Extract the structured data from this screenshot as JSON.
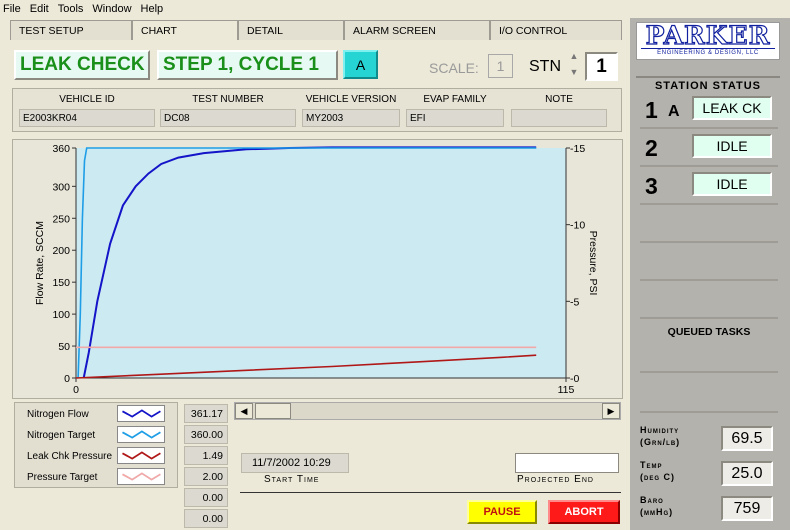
{
  "menu": [
    "File",
    "Edit",
    "Tools",
    "Window",
    "Help"
  ],
  "tabs": [
    "TEST SETUP",
    "CHART",
    "DETAIL",
    "ALARM SCREEN",
    "I/O CONTROL"
  ],
  "header": {
    "mode": "LEAK CHECK",
    "step": "STEP 1, CYCLE  1",
    "station_letter": "A",
    "scale_label": "SCALE:",
    "scale_value": "1",
    "stn_label": "STN",
    "stn_value": "1"
  },
  "info": [
    {
      "header": "VEHICLE ID",
      "value": "E2003KR04"
    },
    {
      "header": "TEST NUMBER",
      "value": "DC08"
    },
    {
      "header": "VEHICLE VERSION",
      "value": "MY2003"
    },
    {
      "header": "EVAP FAMILY",
      "value": "EFI"
    },
    {
      "header": "NOTE",
      "value": ""
    }
  ],
  "chart_data": {
    "type": "line",
    "ylabel": "Flow Rate, SCCM",
    "y2label": "Pressure, PSI",
    "xlim": [
      0,
      115
    ],
    "ylim": [
      0,
      360
    ],
    "y2lim": [
      0,
      15
    ],
    "x_ticks": [
      "0",
      "115"
    ],
    "y_ticks": [
      "0",
      "50",
      "100",
      "150",
      "200",
      "250",
      "300",
      "360"
    ],
    "y2_ticks": [
      "-0",
      "-5",
      "-10",
      "-15"
    ],
    "grid": false,
    "series": [
      {
        "name": "Nitrogen Flow",
        "axis": "left",
        "color": "#1414c8",
        "x": [
          1.8,
          3,
          5,
          8,
          11,
          14,
          17,
          20,
          24,
          30,
          40,
          50,
          60,
          80,
          100,
          108
        ],
        "y": [
          0,
          40,
          120,
          210,
          270,
          300,
          320,
          335,
          345,
          352,
          358,
          360,
          361,
          361,
          361,
          361
        ]
      },
      {
        "name": "Nitrogen Target",
        "axis": "left",
        "color": "#1e9ee6",
        "x": [
          0.5,
          1,
          1.5,
          2,
          2.5,
          108
        ],
        "y": [
          0,
          100,
          250,
          340,
          360,
          360
        ]
      },
      {
        "name": "Leak Chk Pressure",
        "axis": "right",
        "color": "#b01818",
        "x": [
          0,
          20,
          40,
          60,
          80,
          100,
          108
        ],
        "y": [
          0.0,
          0.25,
          0.5,
          0.75,
          1.05,
          1.35,
          1.49
        ]
      },
      {
        "name": "Pressure Target",
        "axis": "right",
        "color": "#f0a8a8",
        "x": [
          0,
          108
        ],
        "y": [
          2.0,
          2.0
        ]
      }
    ]
  },
  "legend": [
    "Nitrogen Flow",
    "Nitrogen Target",
    "Leak Chk Pressure",
    "Pressure Target"
  ],
  "values": [
    "361.17",
    "360.00",
    "1.49",
    "2.00",
    "0.00",
    "0.00"
  ],
  "start_time": {
    "value": "11/7/2002  10:29",
    "label": "Start Time"
  },
  "projected_end": {
    "value": "",
    "label": "Projected End"
  },
  "buttons": {
    "pause": "PAUSE",
    "abort": "ABORT"
  },
  "logo": {
    "name": "PARKER",
    "sub": "ENGINEERING & DESIGN, LLC"
  },
  "station_status": {
    "title": "STATION STATUS",
    "stations": [
      {
        "num": "1",
        "letter": "A",
        "status": "LEAK CK"
      },
      {
        "num": "2",
        "letter": "",
        "status": "IDLE"
      },
      {
        "num": "3",
        "letter": "",
        "status": "IDLE"
      }
    ],
    "queued_label": "QUEUED TASKS"
  },
  "environment": [
    {
      "label1": "Humidity",
      "label2": "(Grn/lb)",
      "value": "69.5"
    },
    {
      "label1": "Temp",
      "label2": "(deg C)",
      "value": "25.0"
    },
    {
      "label1": "Baro",
      "label2": "(mmHg)",
      "value": "759"
    }
  ],
  "colors": {
    "status_text_green": "#1a8f1a",
    "chart_bg": "#cceaf2",
    "pause": "#ffff00",
    "abort": "#ff1a1a",
    "logo_blue": "#10209e"
  }
}
